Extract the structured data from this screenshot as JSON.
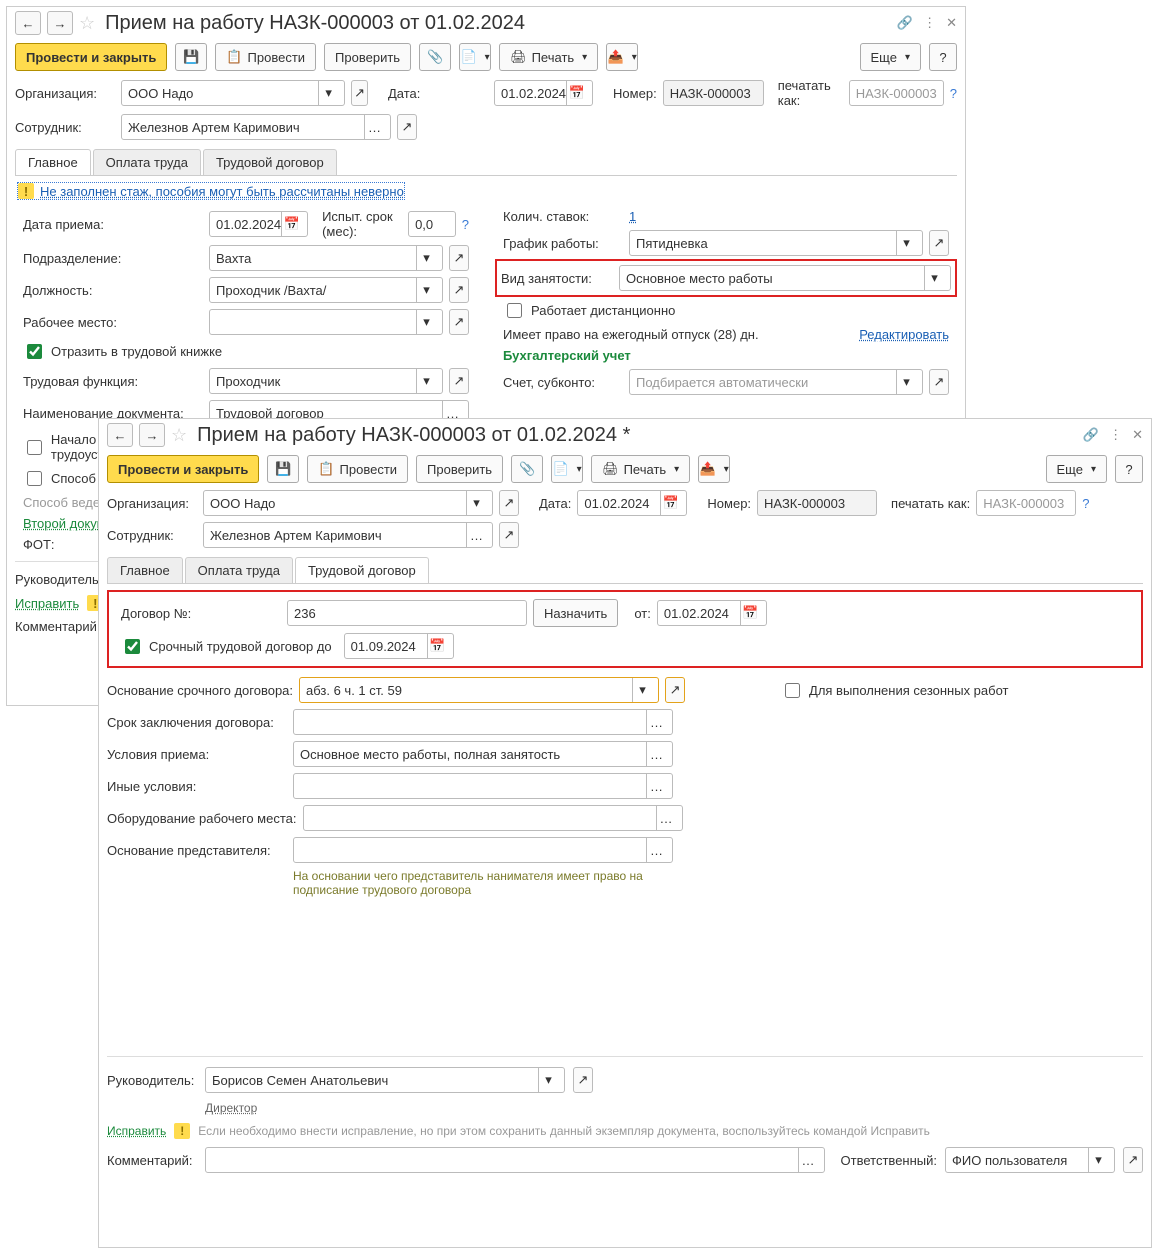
{
  "upper": {
    "title": "Прием на работу НАЗК-000003 от 01.02.2024",
    "toolbar": {
      "save_close": "Провести и закрыть",
      "provesti": "Провести",
      "proverit": "Проверить",
      "pechat": "Печать",
      "more": "Еще",
      "help": "?"
    },
    "org_label": "Организация:",
    "org_value": "ООО Надо",
    "date_label": "Дата:",
    "date_value": "01.02.2024",
    "number_label": "Номер:",
    "number_value": "НАЗК-000003",
    "print_as_label": "печатать как:",
    "print_as_placeholder": "НАЗК-000003",
    "employee_label": "Сотрудник:",
    "employee_value": "Железнов Артем Каримович",
    "tabs": {
      "main": "Главное",
      "pay": "Оплата труда",
      "contract": "Трудовой договор"
    },
    "warn_msg": "Не заполнен стаж, пособия могут быть рассчитаны неверно",
    "date_hire_label": "Дата приема:",
    "date_hire_value": "01.02.2024",
    "probation_label": "Испыт. срок (мес):",
    "probation_value": "0,0",
    "stakes_label": "Колич. ставок:",
    "stakes_value": "1",
    "dept_label": "Подразделение:",
    "dept_value": "Вахта",
    "schedule_label": "График работы:",
    "schedule_value": "Пятидневка",
    "position_label": "Должность:",
    "position_value": "Проходчик /Вахта/",
    "employment_label": "Вид занятости:",
    "employment_value": "Основное место работы",
    "workplace_label": "Рабочее место:",
    "remote_label": "Работает дистанционно",
    "reflect_label": "Отразить в трудовой книжке",
    "vacation_text": "Имеет право на ежегодный отпуск (28) дн.",
    "edit_link": "Редактировать",
    "func_label": "Трудовая функция:",
    "func_value": "Проходчик",
    "account_header": "Бухгалтерский учет",
    "docname_label": "Наименование документа:",
    "docname_value": "Трудовой договор",
    "account_label": "Счет, субконто:",
    "account_placeholder": "Подбирается автоматически",
    "first_job_label": "Начало трудовой деятельности (ранее нигде не был трудоустроен)",
    "method_label": "Способ ве",
    "method2": "Способ веден",
    "second_doc": "Второй докум",
    "fot_label": "ФОТ:",
    "manager_label": "Руководитель:",
    "fix_link": "Исправить",
    "comment_label": "Комментарий:"
  },
  "lower": {
    "title": "Прием на работу НАЗК-000003 от 01.02.2024 *",
    "toolbar": {
      "save_close": "Провести и закрыть",
      "provesti": "Провести",
      "proverit": "Проверить",
      "pechat": "Печать",
      "more": "Еще",
      "help": "?"
    },
    "org_label": "Организация:",
    "org_value": "ООО Надо",
    "date_label": "Дата:",
    "date_value": "01.02.2024",
    "number_label": "Номер:",
    "number_value": "НАЗК-000003",
    "print_as_label": "печатать как:",
    "print_as_placeholder": "НАЗК-000003",
    "employee_label": "Сотрудник:",
    "employee_value": "Железнов Артем Каримович",
    "tabs": {
      "main": "Главное",
      "pay": "Оплата труда",
      "contract": "Трудовой договор"
    },
    "contract_no_label": "Договор №:",
    "contract_no_value": "236",
    "assign_btn": "Назначить",
    "from_label": "от:",
    "from_value": "01.02.2024",
    "fixed_term_label": "Срочный трудовой договор до",
    "fixed_term_value": "01.09.2024",
    "basis_label": "Основание срочного договора:",
    "basis_value": "абз. 6 ч. 1 ст. 59",
    "seasonal_label": "Для выполнения сезонных работ",
    "term_label": "Срок заключения договора:",
    "cond_label": "Условия приема:",
    "cond_value": "Основное место работы, полная занятость",
    "other_label": "Иные условия:",
    "equip_label": "Оборудование рабочего места:",
    "rep_basis_label": "Основание представителя:",
    "rep_hint": "На основании чего представитель нанимателя имеет право на подписание трудового договора",
    "manager_label": "Руководитель:",
    "manager_value": "Борисов Семен Анатольевич",
    "manager_pos": "Директор",
    "fix_link": "Исправить",
    "fix_hint": "Если необходимо внести исправление, но при этом сохранить данный экземпляр документа, воспользуйтесь командой Исправить",
    "comment_label": "Комментарий:",
    "resp_label": "Ответственный:",
    "resp_value": "ФИО пользователя"
  }
}
